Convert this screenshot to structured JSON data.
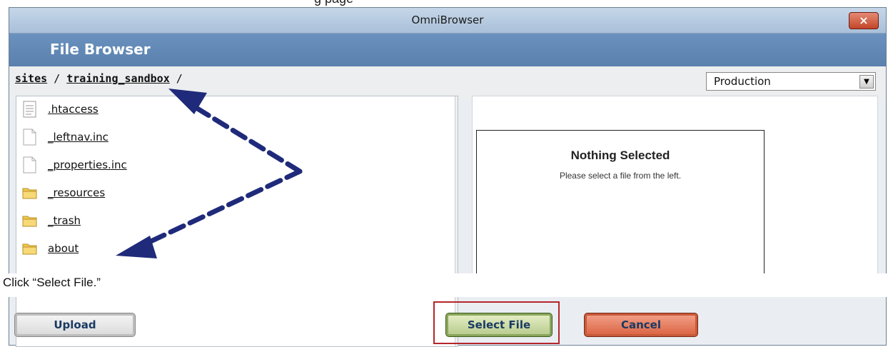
{
  "background_text": "g         page",
  "dialog": {
    "title": "OmniBrowser",
    "close_label": "×",
    "header": "File Browser",
    "breadcrumb": [
      {
        "label": "sites"
      },
      {
        "label": "/"
      },
      {
        "label": "training_sandbox"
      },
      {
        "label": "/"
      }
    ],
    "environment_select": {
      "value": "Production"
    },
    "files": [
      {
        "name": ".htaccess",
        "icon": "text-file-icon"
      },
      {
        "name": "_leftnav.inc",
        "icon": "file-icon"
      },
      {
        "name": "_properties.inc",
        "icon": "file-icon"
      },
      {
        "name": "_resources",
        "icon": "folder-icon"
      },
      {
        "name": "_trash",
        "icon": "folder-icon"
      },
      {
        "name": "about",
        "icon": "folder-icon"
      }
    ],
    "preview": {
      "title": "Nothing Selected",
      "message": "Please select a file from the left."
    },
    "buttons": {
      "upload": "Upload",
      "select_file": "Select File",
      "cancel": "Cancel"
    }
  },
  "instruction": "Click “Select File.”",
  "colors": {
    "header_blue": "#5f86b3",
    "arrow_navy": "#1f2a7a",
    "highlight_red": "#b5262b"
  }
}
